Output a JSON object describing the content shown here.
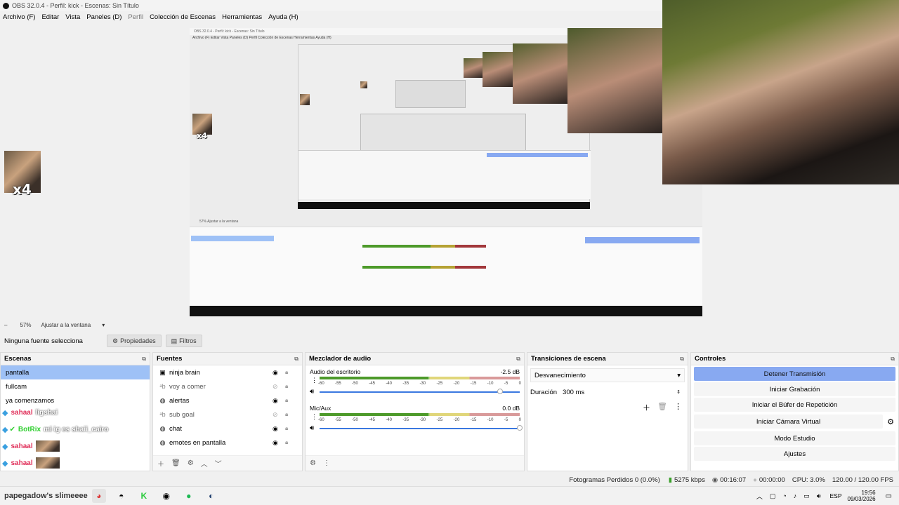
{
  "window": {
    "title": "OBS 32.0.4 - Perfil: kick - Escenas: Sin Título",
    "controls": [
      "—",
      "☐",
      "✕"
    ]
  },
  "menu": [
    {
      "label": "Archivo (F)",
      "enabled": true
    },
    {
      "label": "Editar",
      "enabled": true
    },
    {
      "label": "Vista",
      "enabled": true
    },
    {
      "label": "Paneles (D)",
      "enabled": true
    },
    {
      "label": "Perfil",
      "enabled": false
    },
    {
      "label": "Colección de Escenas",
      "enabled": true
    },
    {
      "label": "Herramientas",
      "enabled": true
    },
    {
      "label": "Ayuda (H)",
      "enabled": true
    }
  ],
  "preview": {
    "badge": "x4",
    "nested_title": "OBS 32.0.4 - Perfil: kick - Escenas: Sin Título",
    "nested_menu": "Archivo (F)  Editar  Vista  Paneles (D)  Perfil  Colección de Escenas  Herramientas  Ayuda (H)"
  },
  "zoom": {
    "value": "57%",
    "fit_label": "Ajustar a la ventana"
  },
  "source_bar": {
    "no_source": "Ninguna fuente selecciona",
    "properties": "Propiedades",
    "filters": "Filtros"
  },
  "scenes": {
    "title": "Escenas",
    "items": [
      {
        "label": "pantalla",
        "selected": true
      },
      {
        "label": "fullcam",
        "selected": false
      },
      {
        "label": "ya comenzamos",
        "selected": false
      }
    ]
  },
  "sources": {
    "title": "Fuentes",
    "items": [
      {
        "label": "ninja brain",
        "icon": "window-icon",
        "visible": true
      },
      {
        "label": "voy a comer",
        "icon": "text-icon",
        "visible": false
      },
      {
        "label": "alertas",
        "icon": "browser-icon",
        "visible": true
      },
      {
        "label": "sub goal",
        "icon": "text-icon",
        "visible": false
      },
      {
        "label": "chat",
        "icon": "browser-icon",
        "visible": true
      },
      {
        "label": "emotes en pantalla",
        "icon": "browser-icon",
        "visible": true
      }
    ]
  },
  "mixer": {
    "title": "Mezclador de audio",
    "ticks": [
      "-60",
      "-55",
      "-50",
      "-45",
      "-40",
      "-35",
      "-30",
      "-25",
      "-20",
      "-15",
      "-10",
      "-5",
      "0"
    ],
    "channels": [
      {
        "name": "Audio del escritorio",
        "db": "-2.5 dB",
        "volume": 0.9
      },
      {
        "name": "Mic/Aux",
        "db": "0.0 dB",
        "volume": 1.0
      }
    ]
  },
  "transitions": {
    "title": "Transiciones de escena",
    "selected": "Desvanecimiento",
    "duration_label": "Duración",
    "duration_value": "300 ms"
  },
  "controls": {
    "title": "Controles",
    "buttons": [
      {
        "label": "Detener Transmisión",
        "primary": true
      },
      {
        "label": "Iniciar Grabación",
        "primary": false
      },
      {
        "label": "Iniciar el Búfer de Repetición",
        "primary": false
      },
      {
        "label": "Iniciar Cámara Virtual",
        "primary": false
      },
      {
        "label": "Modo Estudio",
        "primary": false
      },
      {
        "label": "Ajustes",
        "primary": false
      }
    ]
  },
  "status": {
    "dropped_frames": "Fotogramas Perdidos 0 (0.0%)",
    "bitrate": "5275 kbps",
    "stream_time": "00:16:07",
    "record_time": "00:00:00",
    "cpu": "CPU: 3.0%",
    "fps": "120.00 / 120.00 FPS"
  },
  "chat_overlay": [
    {
      "user": "sahaal",
      "message": "ligshai",
      "color": "#e0305a"
    },
    {
      "user": "BotRix",
      "message": "mi ig es shaii_cairo",
      "color": "#2fcf2f"
    },
    {
      "user": "sahaal",
      "message": "",
      "color": "#e0305a"
    },
    {
      "user": "sahaal",
      "message": "",
      "color": "#e0305a"
    },
    {
      "user": "sahaal",
      "message": "",
      "color": "#e0305a"
    }
  ],
  "taskbar": {
    "label": "papegadow's slimeeee",
    "time": "19:56",
    "date": "09/03/2026",
    "lang": "ESP"
  }
}
